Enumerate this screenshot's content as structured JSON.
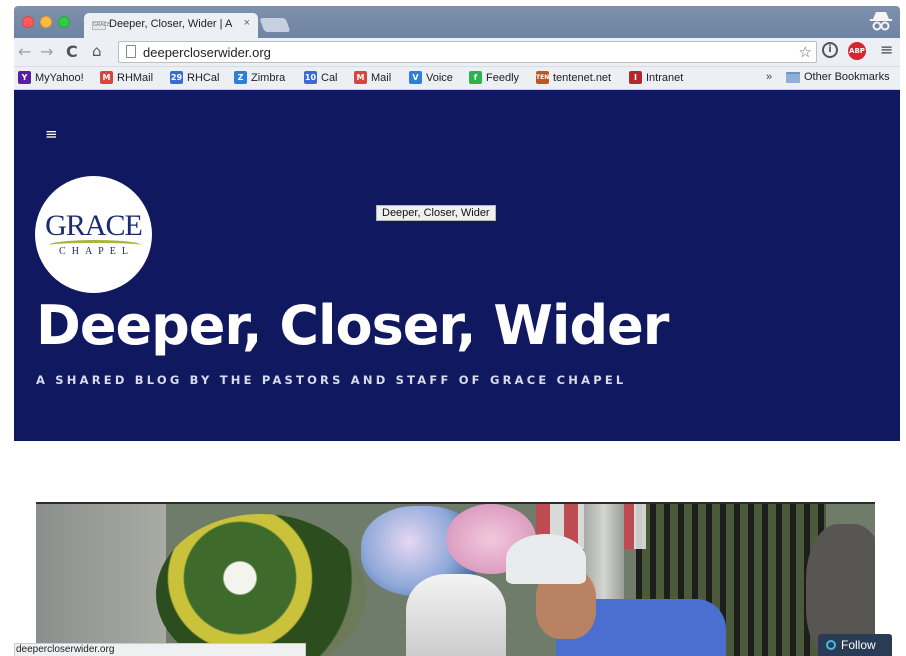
{
  "browser": {
    "tab_title": "Deeper, Closer, Wider | A s",
    "tab_close": "×",
    "tab_favicon_text": "GRACE",
    "url": "deepercloserwider.org",
    "nav": {
      "back": "←",
      "forward": "→",
      "reload": "C",
      "home": "⌂",
      "menu": "≡"
    },
    "omnibox_icons": "☆",
    "info_label": "i",
    "abp_label": "ABP",
    "bookmarks": [
      {
        "label": "MyYahoo!",
        "icon": "Y",
        "color": "#5a1fa0"
      },
      {
        "label": "RHMail",
        "icon": "M",
        "color": "#d9453d"
      },
      {
        "label": "RHCal",
        "icon": "29",
        "color": "#3b6cd4"
      },
      {
        "label": "Zimbra",
        "icon": "Z",
        "color": "#2f7fd6"
      },
      {
        "label": "Cal",
        "icon": "10",
        "color": "#3b6cd4"
      },
      {
        "label": "Mail",
        "icon": "M",
        "color": "#d9453d"
      },
      {
        "label": "Voice",
        "icon": "V",
        "color": "#2f7fd6"
      },
      {
        "label": "Feedly",
        "icon": "f",
        "color": "#2bb24c"
      },
      {
        "label": "tentenet.net",
        "icon": "TEN",
        "color": "#c0561c"
      },
      {
        "label": "Intranet",
        "icon": "I",
        "color": "#b3282d"
      }
    ],
    "bookmarks_more": "»",
    "other_bookmarks": "Other Bookmarks"
  },
  "site": {
    "menu_icon": "≡",
    "logo_top": "GRACE",
    "logo_bottom": "CHAPEL",
    "tooltip": "Deeper, Closer, Wider",
    "title": "Deeper, Closer, Wider",
    "tagline": "A SHARED BLOG BY THE PASTORS AND STAFF OF GRACE CHAPEL"
  },
  "status_bar": "deepercloserwider.org",
  "follow_label": "Follow",
  "colors": {
    "header_bg": "#101860",
    "follow_bg": "#293b55"
  }
}
